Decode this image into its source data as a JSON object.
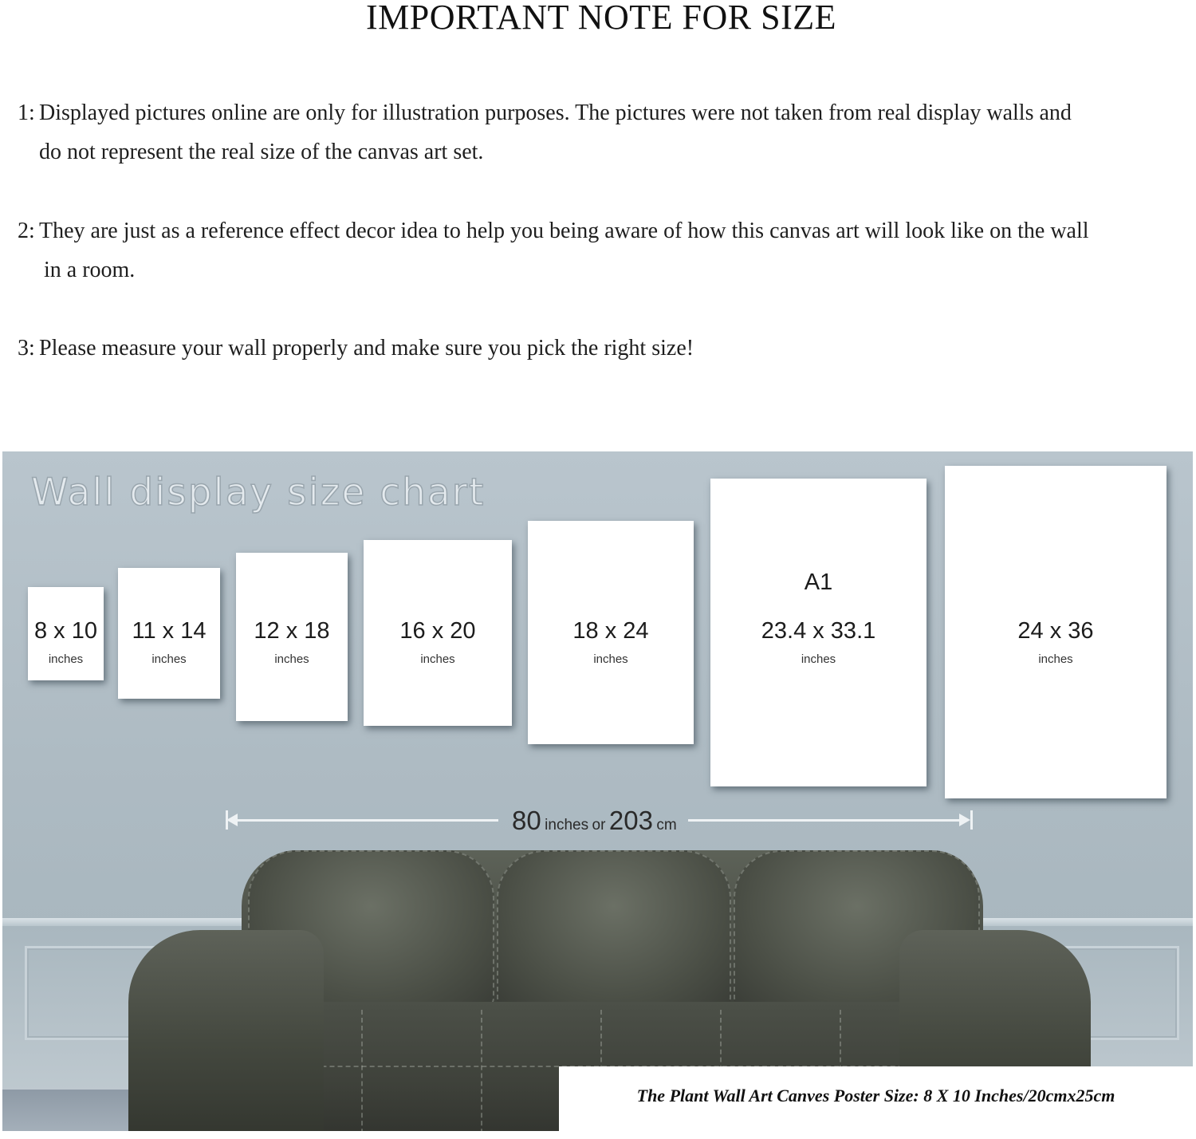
{
  "title": "IMPORTANT NOTE FOR SIZE",
  "notes": [
    {
      "num": "1:",
      "line1": "Displayed pictures online are only for illustration purposes. The pictures were not taken from real display walls and",
      "line2": "do not represent the real size of the canvas art set."
    },
    {
      "num": "2:",
      "line1": "They are just as a reference effect decor idea to help you being aware of how this canvas art will look like on the wall",
      "line2": "in a room."
    },
    {
      "num": "3:",
      "line1": "Please measure your wall properly and make sure you pick the right size!"
    }
  ],
  "wall_chart": {
    "heading": "Wall display size chart",
    "frames": [
      {
        "size": "8 x 10",
        "unit": "inches"
      },
      {
        "size": "11 x 14",
        "unit": "inches"
      },
      {
        "size": "12 x 18",
        "unit": "inches"
      },
      {
        "size": "16 x 20",
        "unit": "inches"
      },
      {
        "size": "18 x 24",
        "unit": "inches"
      },
      {
        "label": "A1",
        "size": "23.4 x 33.1",
        "unit": "inches"
      },
      {
        "size": "24 x 36",
        "unit": "inches"
      }
    ],
    "measure": {
      "value1": "80",
      "unit1": "inches",
      "or": "or",
      "value2": "203",
      "unit2": "cm"
    }
  },
  "caption": "The Plant Wall Art Canves Poster Size: 8 X 10 Inches/20cmx25cm",
  "colors": {
    "wall": "#b5c2ca",
    "sofa": "#4a4e46",
    "frame": "#ffffff"
  }
}
